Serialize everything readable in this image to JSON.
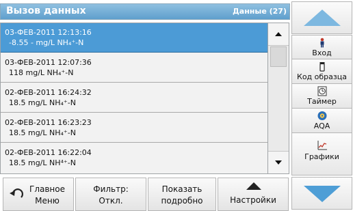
{
  "header": {
    "title": "Вызов данных",
    "count": "Данные (27)"
  },
  "list": {
    "rows": [
      {
        "datetime": "03-ФЕВ-2011 12:13:16",
        "value": "-8.55 - mg/L NH₄⁺-N"
      },
      {
        "datetime": "03-ФЕВ-2011 12:07:36",
        "value": "118 mg/L NH₄⁺-N"
      },
      {
        "datetime": "02-ФЕВ-2011 16:24:32",
        "value": "18.5 mg/L NH₄⁺-N"
      },
      {
        "datetime": "02-ФЕВ-2011 16:23:23",
        "value": "18.5 mg/L NH₄⁺-N"
      },
      {
        "datetime": "02-ФЕВ-2011 16:22:04",
        "value": "18.5 mg/L NH⁴⁺-N"
      }
    ],
    "selected_index": 0
  },
  "sidebar": {
    "buttons": [
      {
        "label": "Вход",
        "icon": "person-icon"
      },
      {
        "label": "Код образца",
        "icon": "sample-vial-icon"
      },
      {
        "label": "Таймер",
        "icon": "timer-icon"
      },
      {
        "label": "AQA",
        "icon": "aqa-icon"
      },
      {
        "label": "Графики",
        "icon": "graph-icon"
      }
    ]
  },
  "bottom": {
    "main_menu": {
      "line1": "Главное",
      "line2": "Меню"
    },
    "filter": {
      "line1": "Фильтр:",
      "line2": "Откл."
    },
    "details": {
      "line1": "Показать",
      "line2": "подробно"
    },
    "settings": {
      "line1": "Настройки"
    }
  },
  "colors": {
    "title_bar": "#5f9fcd",
    "selected_row": "#4c9bd6",
    "arrow": "#4e9ed6"
  }
}
